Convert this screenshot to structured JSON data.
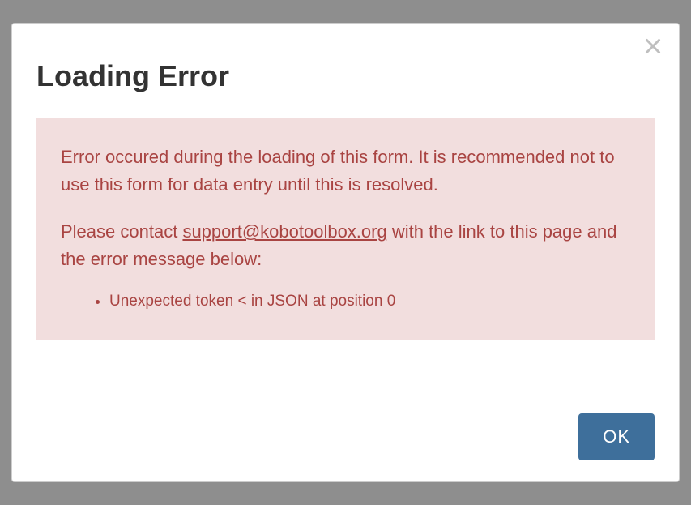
{
  "modal": {
    "title": "Loading Error",
    "alert": {
      "paragraph1": "Error occured during the loading of this form. It is recommended not to use this form for data entry until this is resolved.",
      "paragraph2_prefix": "Please contact ",
      "paragraph2_link": "support@kobotoolbox.org",
      "paragraph2_suffix": " with the link to this page and the error message below:",
      "errors": [
        "Unexpected token < in JSON at position 0"
      ]
    },
    "ok_label": "OK"
  }
}
